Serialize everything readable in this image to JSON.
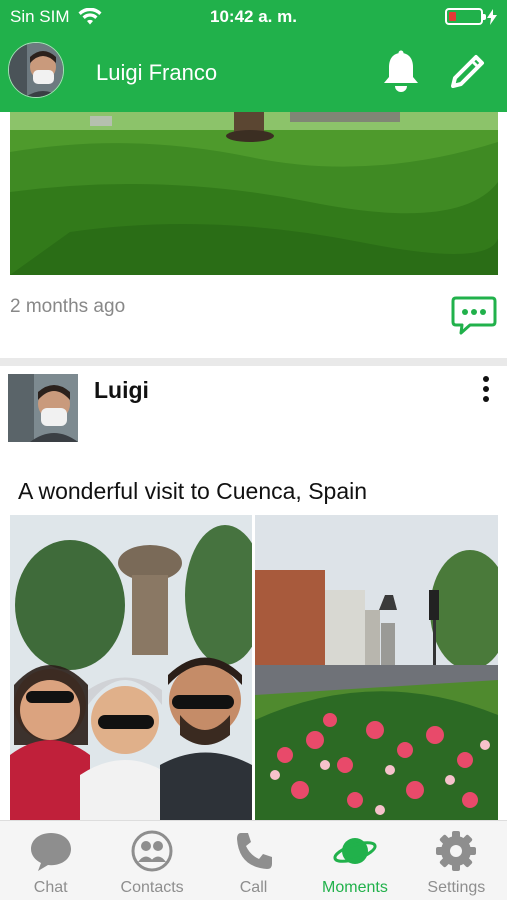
{
  "status_bar": {
    "carrier": "Sin SIM",
    "time": "10:42 a. m."
  },
  "header": {
    "user_name": "Luigi Franco"
  },
  "feed": {
    "post1": {
      "timestamp": "2 months ago"
    },
    "post2": {
      "author": "Luigi",
      "caption": "A wonderful visit to Cuenca, Spain"
    }
  },
  "tabs": [
    {
      "label": "Chat",
      "icon": "chat-bubble-icon",
      "active": false
    },
    {
      "label": "Contacts",
      "icon": "contacts-icon",
      "active": false
    },
    {
      "label": "Call",
      "icon": "phone-icon",
      "active": false
    },
    {
      "label": "Moments",
      "icon": "planet-icon",
      "active": true
    },
    {
      "label": "Settings",
      "icon": "gear-icon",
      "active": false
    }
  ],
  "colors": {
    "brand_green": "#21b14b",
    "inactive_gray": "#8e8e8e",
    "battery_low": "#e53935"
  }
}
